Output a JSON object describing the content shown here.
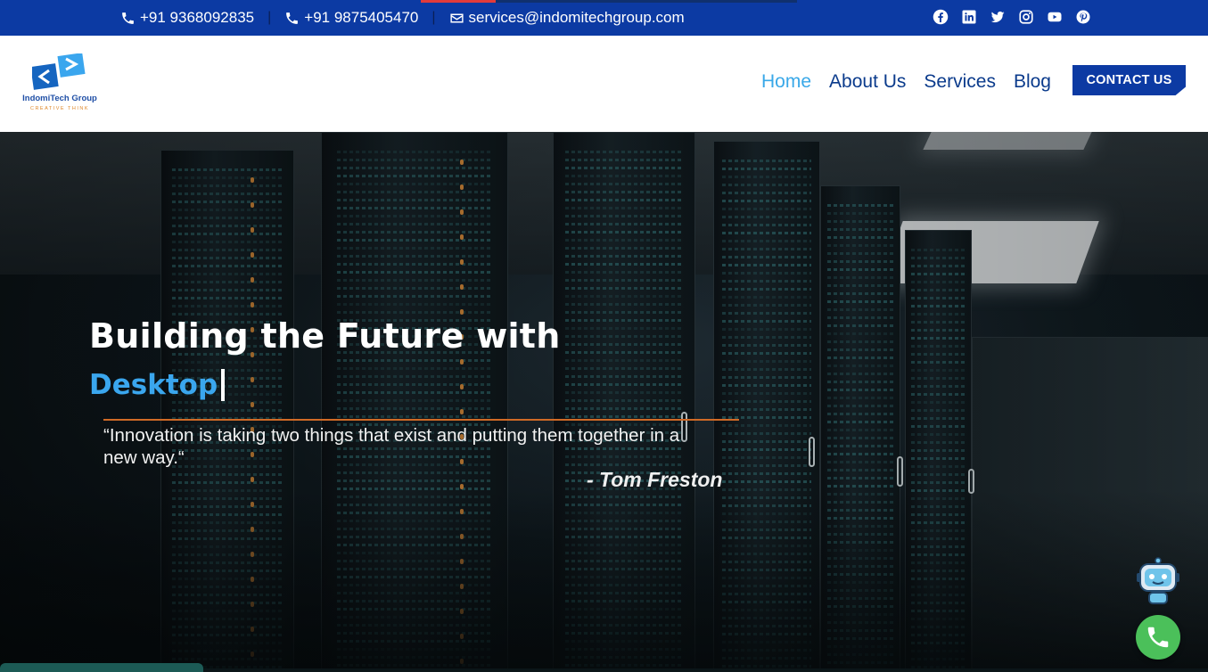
{
  "topbar": {
    "phone1": "+91 9368092835",
    "phone2": "+91 9875405470",
    "email": "services@indomitechgroup.com",
    "separator": "|",
    "socials": [
      "facebook-icon",
      "linkedin-icon",
      "twitter-icon",
      "instagram-icon",
      "youtube-icon",
      "pinterest-icon"
    ]
  },
  "header": {
    "logo_name": "IndomiTech Group",
    "logo_tagline": "CREATIVE THINK",
    "nav": [
      {
        "label": "Home",
        "active": true
      },
      {
        "label": "About Us",
        "active": false
      },
      {
        "label": "Services",
        "active": false
      },
      {
        "label": "Blog",
        "active": false
      }
    ],
    "cta_label": "CONTACT US"
  },
  "hero": {
    "title": "Building the Future with",
    "typed_word": "Desktop",
    "quote": "“Innovation is taking two things that exist and putting them together in a new way.“",
    "author": "- Tom Freston"
  },
  "colors": {
    "brand_blue": "#0c3aa3",
    "accent_light_blue": "#3aa6ee",
    "quote_line": "#d06a26",
    "call_green": "#4bc05a"
  }
}
